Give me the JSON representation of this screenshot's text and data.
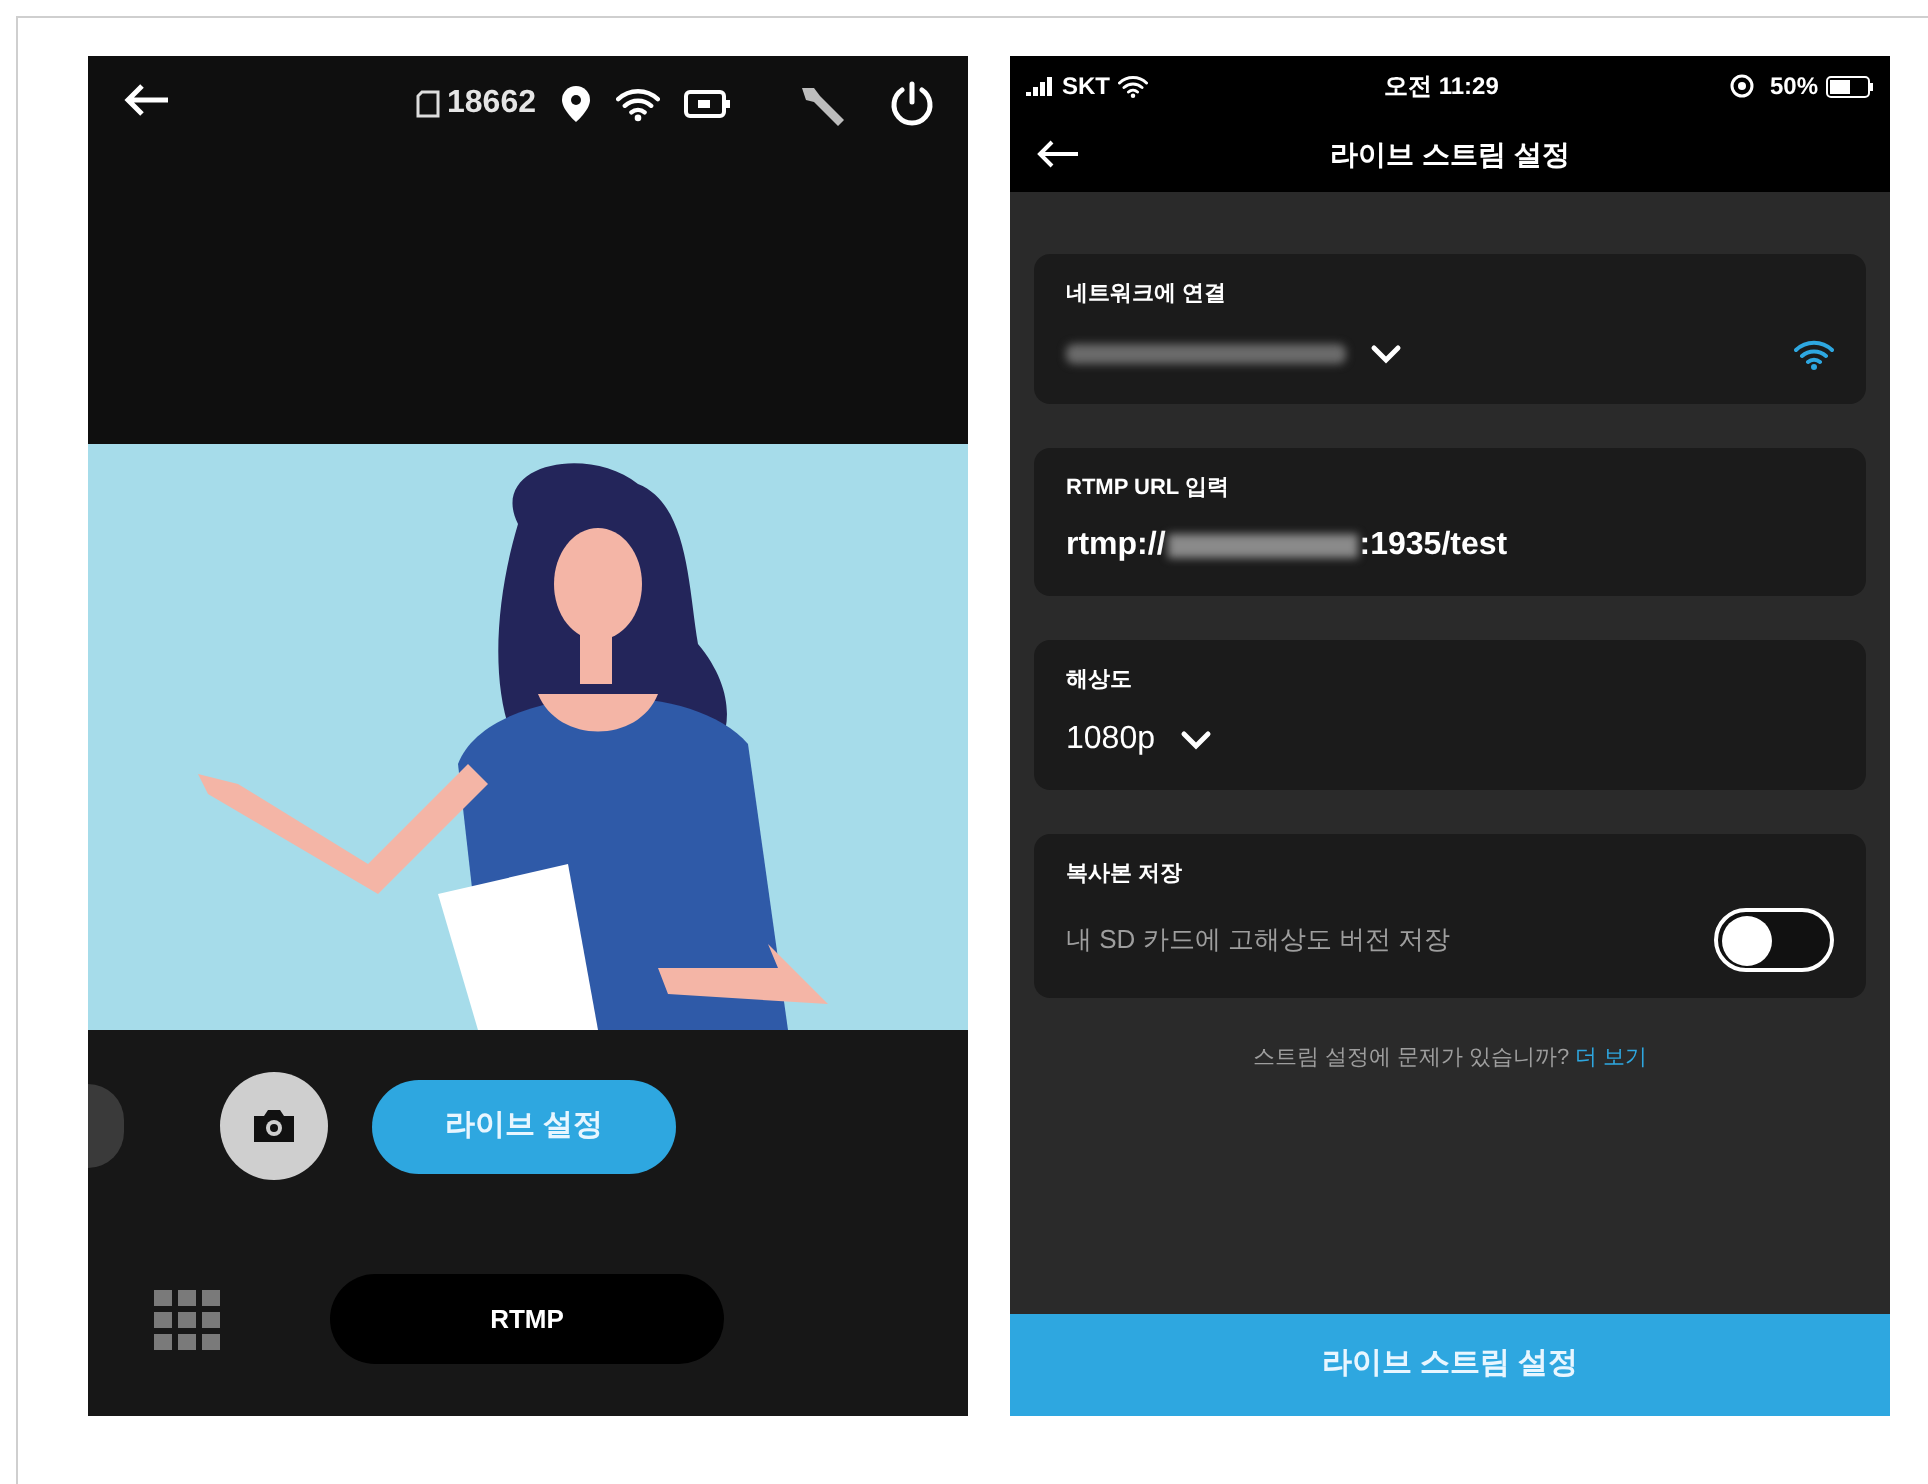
{
  "camera_screen": {
    "status": {
      "storage_count": "18662"
    },
    "live_button": "라이브 설정",
    "mode_button": "RTMP"
  },
  "settings_screen": {
    "status_bar": {
      "carrier": "SKT",
      "time": "오전 11:29",
      "battery": "50%"
    },
    "title": "라이브 스트림 설정",
    "network": {
      "label": "네트워크에 연결"
    },
    "rtmp": {
      "label": "RTMP URL 입력",
      "prefix": "rtmp://",
      "suffix": ":1935/test"
    },
    "resolution": {
      "label": "해상도",
      "value": "1080p"
    },
    "copy": {
      "label": "복사본 저장",
      "description": "내 SD 카드에 고해상도 버전 저장",
      "on": false
    },
    "help": {
      "text": "스트림 설정에 문제가 있습니까?",
      "link": "더 보기"
    },
    "submit": "라이브 스트림 설정"
  }
}
